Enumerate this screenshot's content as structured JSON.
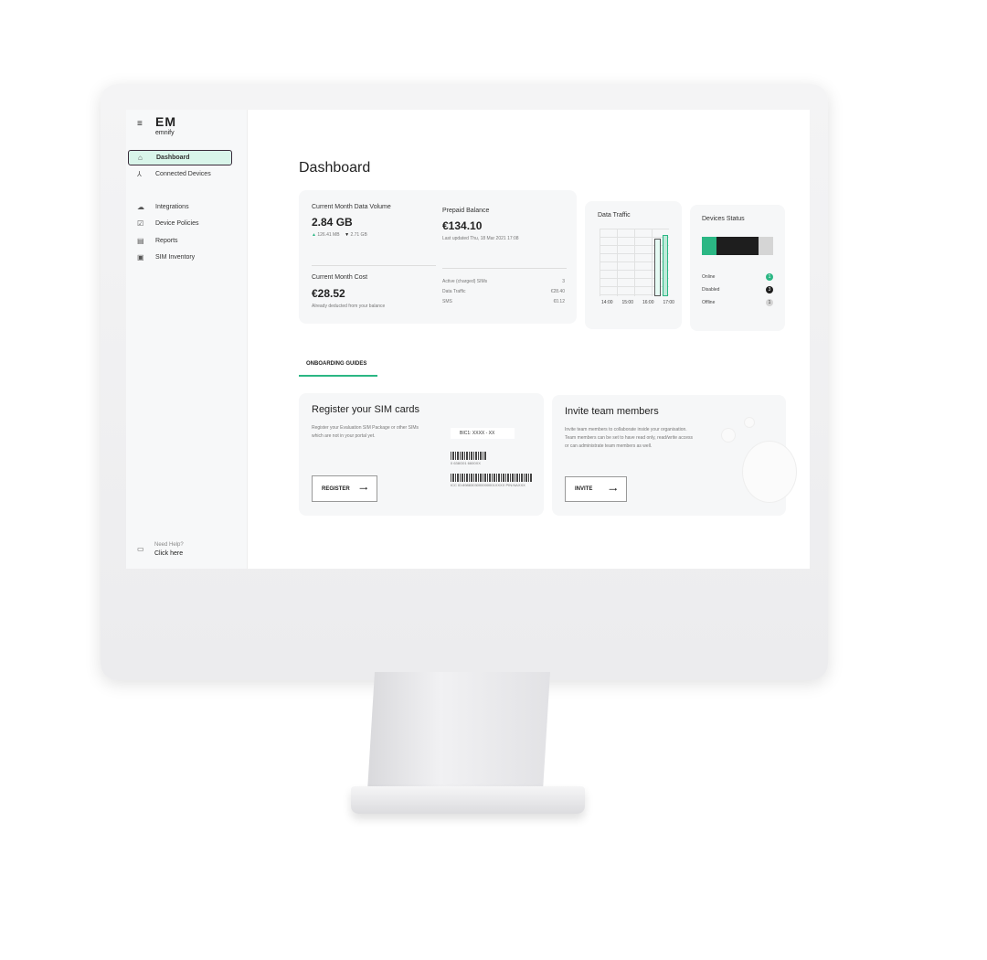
{
  "brand": {
    "logo": "EM",
    "name": "emnify"
  },
  "sidebar": {
    "items": [
      {
        "label": "Dashboard",
        "icon": "home-icon",
        "active": true
      },
      {
        "label": "Connected Devices",
        "icon": "network-icon"
      },
      {
        "label": "Integrations",
        "icon": "cloud-icon"
      },
      {
        "label": "Device Policies",
        "icon": "checklist-icon"
      },
      {
        "label": "Reports",
        "icon": "report-icon"
      },
      {
        "label": "SIM Inventory",
        "icon": "sim-icon"
      }
    ],
    "help_title": "Need Help?",
    "help_link": "Click here"
  },
  "page_title": "Dashboard",
  "summary": {
    "data_volume_label": "Current Month Data Volume",
    "data_volume": "2.84 GB",
    "upload": "126.41 MB",
    "download": "2.71 GB",
    "balance_label": "Prepaid Balance",
    "balance": "€134.10",
    "balance_updated": "Last updated Thu, 18 Mar 2021 17:08",
    "cost_label": "Current Month Cost",
    "cost": "€28.52",
    "cost_note": "Already deducted from your balance",
    "rows": [
      {
        "label": "Active (charged) SIMs",
        "value": "3"
      },
      {
        "label": "Data Traffic",
        "value": "€28.40"
      },
      {
        "label": "SMS",
        "value": "€0.12"
      }
    ]
  },
  "traffic": {
    "title": "Data Traffic",
    "ticks": [
      "14:00",
      "15:00",
      "16:00",
      "17:00"
    ]
  },
  "status": {
    "title": "Devices Status",
    "items": [
      {
        "label": "Online",
        "count": "1",
        "color": "#2bb784"
      },
      {
        "label": "Disabled",
        "count": "3",
        "color": "#1e1e1e"
      },
      {
        "label": "Offline",
        "count": "1",
        "color": "#d5d5d5"
      }
    ]
  },
  "tabs": {
    "onboarding": "ONBOARDING GUIDES"
  },
  "register": {
    "title": "Register your SIM cards",
    "text": "Register your Evaluation SIM Package or other SIMs which are not in your portal yet.",
    "field": "BIC1: XXXX - XX",
    "code1": "0 638G01 6600XX",
    "code2": "ICC ID:8988303000000001XXXX PIN:NAXXX",
    "button": "REGISTER"
  },
  "invite": {
    "title": "Invite team members",
    "text": "Invite team members to collaborate inside your organisation. Team members can be set to have read only, read/write access or can administrate team members as well.",
    "button": "INVITE"
  },
  "accent": "#2bb784"
}
